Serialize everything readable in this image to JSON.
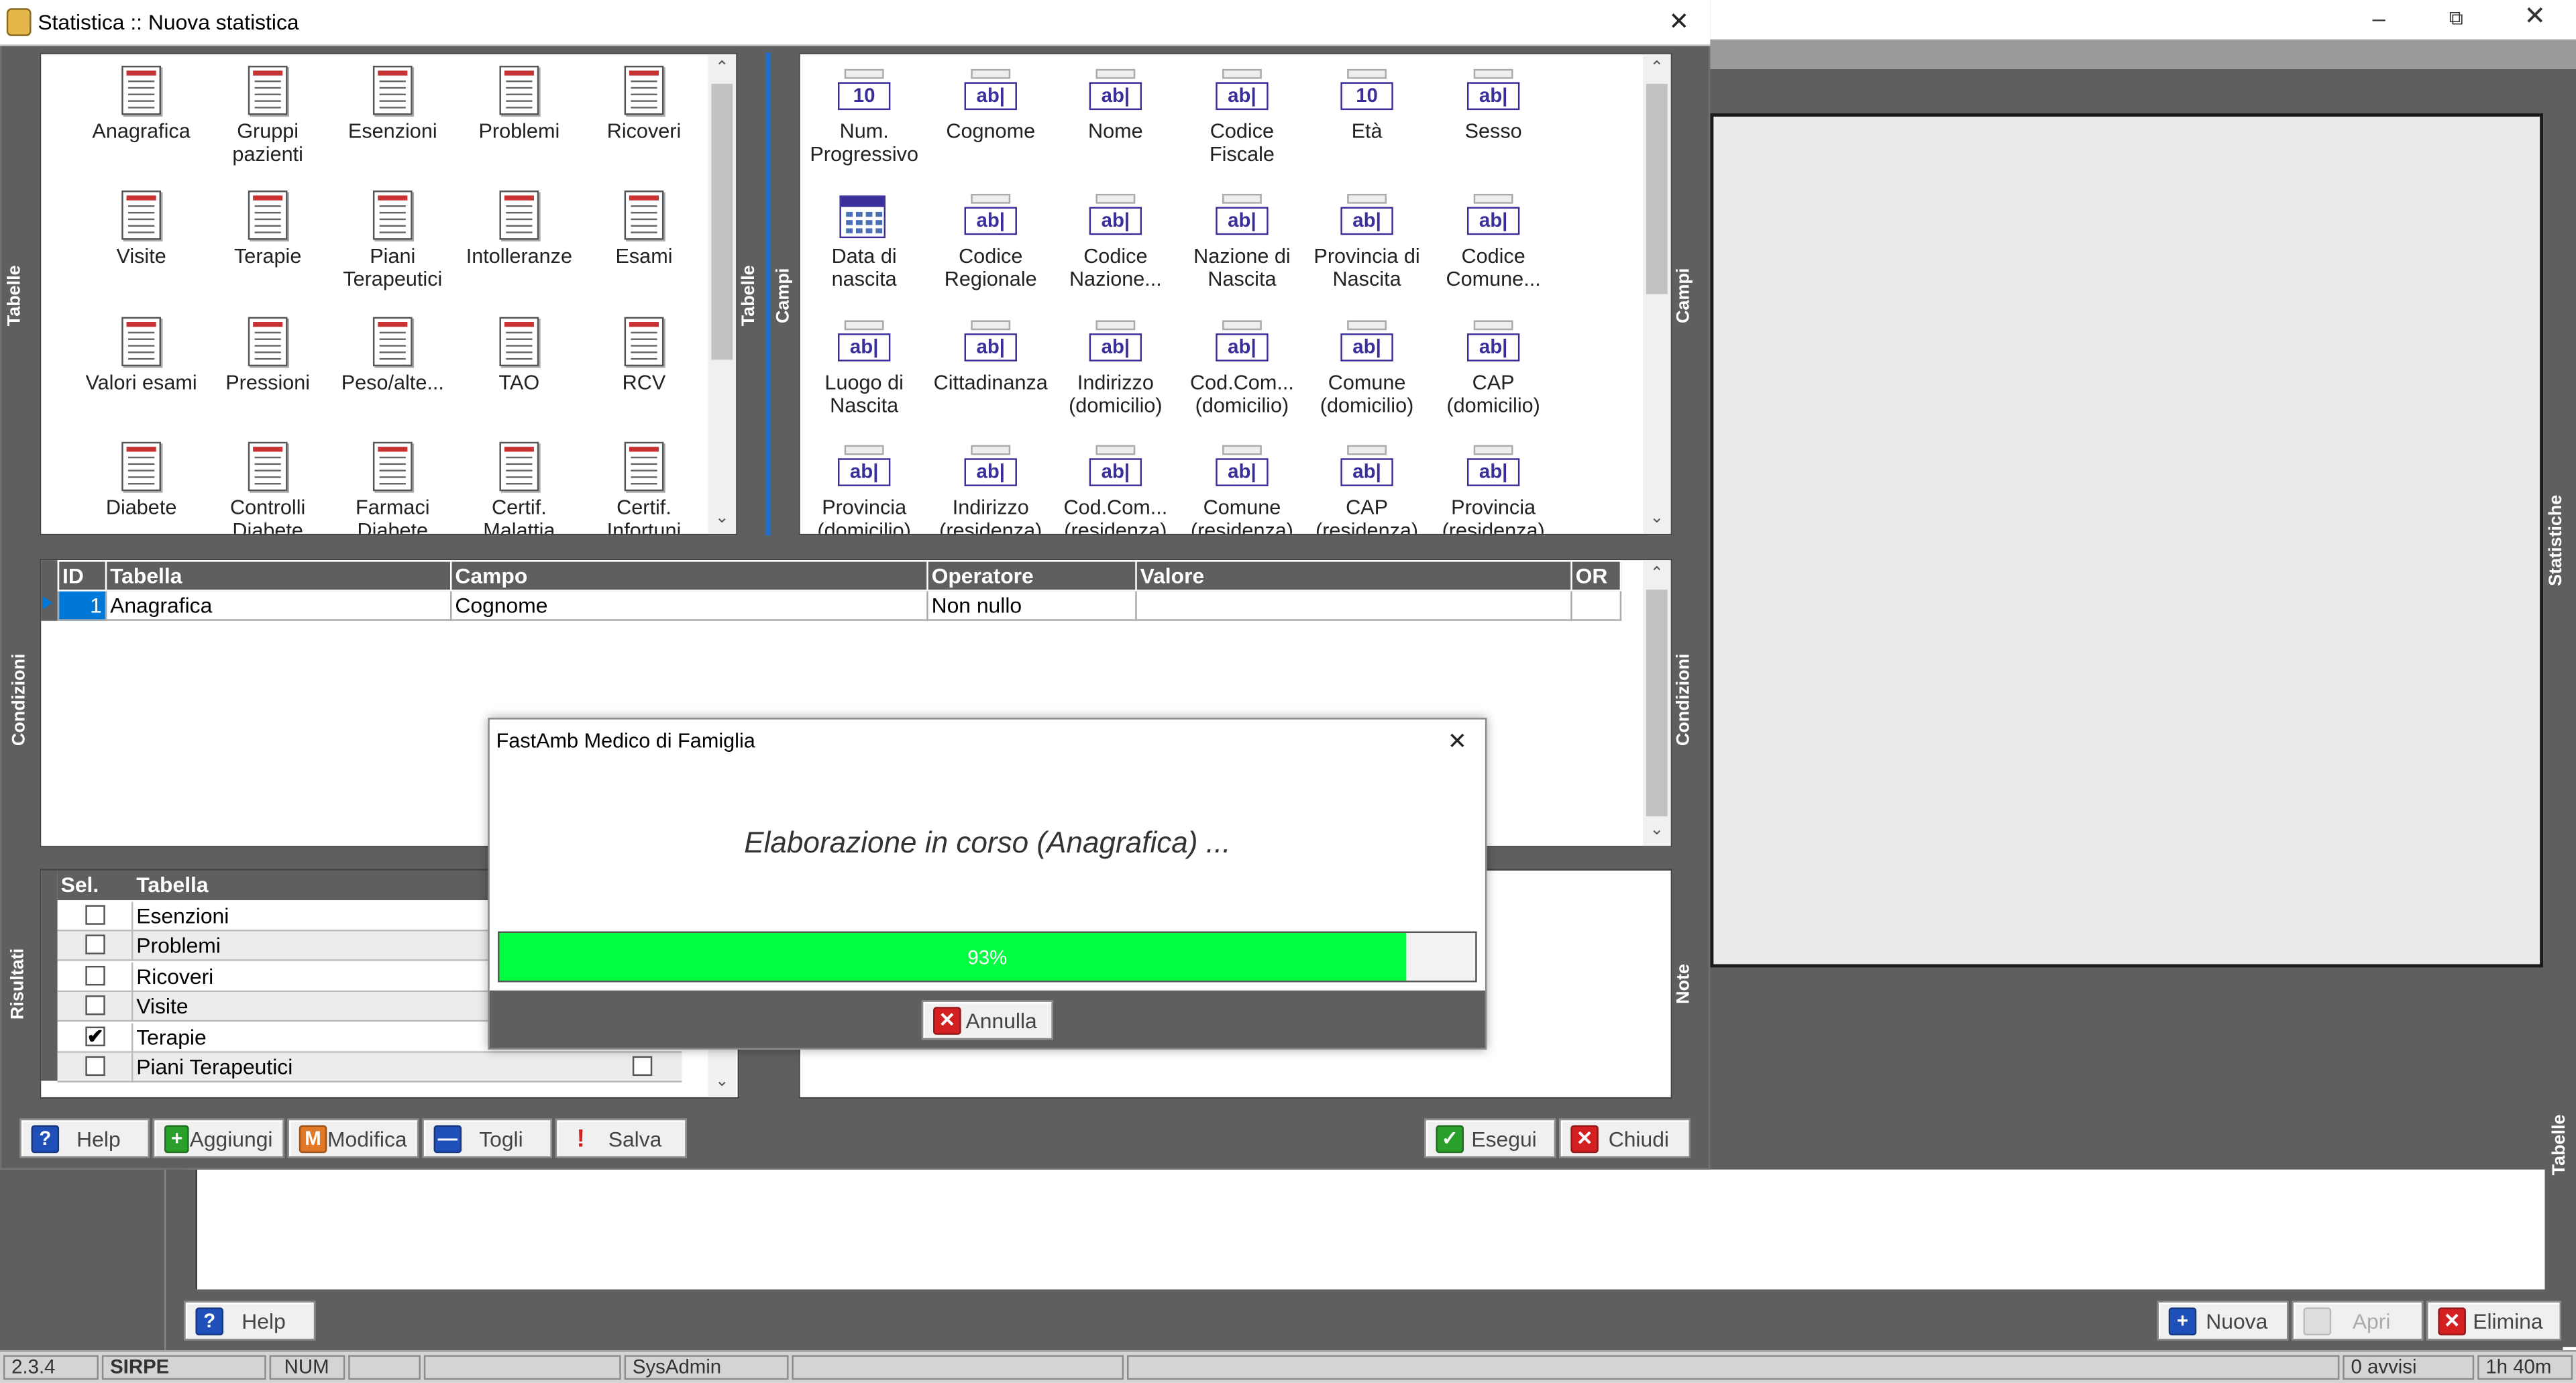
{
  "window": {
    "title": "Statistica :: Nuova statistica"
  },
  "side_labels": {
    "tabelle": "Tabelle",
    "campi": "Campi",
    "condizioni": "Condizioni",
    "risultati": "Risultati",
    "note": "Note",
    "statistiche": "Statistiche"
  },
  "tables_panel": {
    "items": [
      "Anagrafica",
      "Gruppi pazienti",
      "Esenzioni",
      "Problemi",
      "Ricoveri",
      "Visite",
      "Terapie",
      "Piani Terapeutici",
      "Intolleranze",
      "Esami",
      "Valori esami",
      "Pressioni",
      "Peso/alte...",
      "TAO",
      "RCV",
      "Diabete",
      "Controlli Diabete",
      "Farmaci Diabete",
      "Certif. Malattia",
      "Certif. Infortuni"
    ]
  },
  "fields_panel": {
    "items": [
      {
        "label": "Num. Progressivo",
        "icon": "number-field-icon"
      },
      {
        "label": "Cognome",
        "icon": "text-field-icon"
      },
      {
        "label": "Nome",
        "icon": "text-field-icon"
      },
      {
        "label": "Codice Fiscale",
        "icon": "text-field-icon"
      },
      {
        "label": "Età",
        "icon": "number-field-icon"
      },
      {
        "label": "Sesso",
        "icon": "text-field-icon"
      },
      {
        "label": "Data di nascita",
        "icon": "date-field-icon"
      },
      {
        "label": "Codice Regionale",
        "icon": "text-field-icon"
      },
      {
        "label": "Codice Nazione...",
        "icon": "text-field-icon"
      },
      {
        "label": "Nazione di Nascita",
        "icon": "text-field-icon"
      },
      {
        "label": "Provincia di Nascita",
        "icon": "text-field-icon"
      },
      {
        "label": "Codice Comune...",
        "icon": "text-field-icon"
      },
      {
        "label": "Luogo di Nascita",
        "icon": "text-field-icon"
      },
      {
        "label": "Cittadinanza",
        "icon": "text-field-icon"
      },
      {
        "label": "Indirizzo (domicilio)",
        "icon": "text-field-icon"
      },
      {
        "label": "Cod.Com... (domicilio)",
        "icon": "text-field-icon"
      },
      {
        "label": "Comune (domicilio)",
        "icon": "text-field-icon"
      },
      {
        "label": "CAP (domicilio)",
        "icon": "text-field-icon"
      },
      {
        "label": "Provincia (domicilio)",
        "icon": "text-field-icon"
      },
      {
        "label": "Indirizzo (residenza)",
        "icon": "text-field-icon"
      },
      {
        "label": "Cod.Com... (residenza)",
        "icon": "text-field-icon"
      },
      {
        "label": "Comune (residenza)",
        "icon": "text-field-icon"
      },
      {
        "label": "CAP (residenza)",
        "icon": "text-field-icon"
      },
      {
        "label": "Provincia (residenza)",
        "icon": "text-field-icon"
      }
    ]
  },
  "icon_text": {
    "number": "10",
    "text": "ab|"
  },
  "conditions": {
    "headers": {
      "id": "ID",
      "tabella": "Tabella",
      "campo": "Campo",
      "operatore": "Operatore",
      "valore": "Valore",
      "or": "OR"
    },
    "rows": [
      {
        "id": "1",
        "tabella": "Anagrafica",
        "campo": "Cognome",
        "operatore": "Non nullo",
        "valore": "",
        "or": ""
      }
    ]
  },
  "results": {
    "headers": {
      "sel": "Sel.",
      "tabella": "Tabella"
    },
    "rows": [
      {
        "tabella": "Esenzioni",
        "checked": false
      },
      {
        "tabella": "Problemi",
        "checked": false
      },
      {
        "tabella": "Ricoveri",
        "checked": false
      },
      {
        "tabella": "Visite",
        "checked": false
      },
      {
        "tabella": "Terapie",
        "checked": true
      },
      {
        "tabella": "Piani Terapeutici",
        "checked": false
      }
    ]
  },
  "toolbar": {
    "help": "Help",
    "aggiungi": "Aggiungi",
    "modifica": "Modifica",
    "togli": "Togli",
    "salva": "Salva",
    "esegui": "Esegui",
    "chiudi": "Chiudi"
  },
  "dialog": {
    "title": "FastAmb Medico di Famiglia",
    "message": "Elaborazione in corso (Anagrafica) ...",
    "progress_percent": 93,
    "progress_label": "93%",
    "cancel": "Annulla"
  },
  "main_window": {
    "help": "Help",
    "nuova": "Nuova",
    "apri": "Apri",
    "elimina": "Elimina"
  },
  "status_bar": {
    "version": "2.3.4",
    "db": "SIRPE",
    "num": "NUM",
    "user": "SysAdmin",
    "avvisi": "0 avvisi",
    "time": "1h 40m"
  },
  "colors": {
    "panel_gray": "#5f5f5f",
    "progress_green": "#00ff40",
    "selection_blue": "#0078d7",
    "icon_purple": "#3a2f9a"
  }
}
